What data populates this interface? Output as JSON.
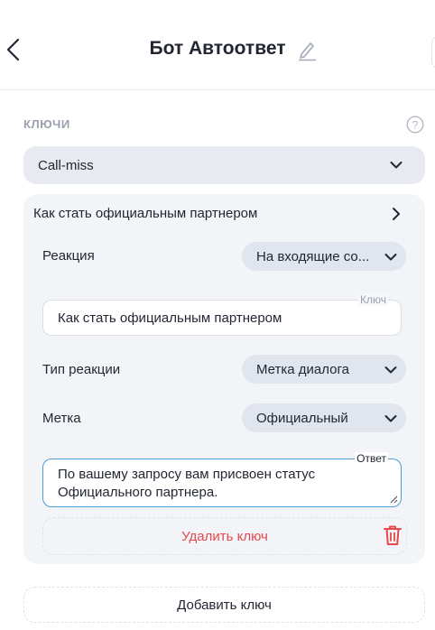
{
  "header": {
    "title": "Бот Автоответ",
    "back_icon": "chevron-left-icon",
    "edit_icon": "pencil-icon"
  },
  "keys_section": {
    "label": "КЛЮЧИ",
    "help_icon": "question-circle-icon",
    "selected": "Call-miss"
  },
  "panel": {
    "title": "Как стать официальным партнером",
    "reaction": {
      "label": "Реакция",
      "value": "На входящие со..."
    },
    "key_field": {
      "legend": "Ключ",
      "value": "Как стать официальным партнером"
    },
    "reaction_type": {
      "label": "Тип реакции",
      "value": "Метка диалога"
    },
    "tag": {
      "label": "Метка",
      "value": "Официальный"
    },
    "answer_field": {
      "legend": "Ответ",
      "line1": "По вашему запросу вам присвоен статус",
      "line2": "Официального партнера."
    },
    "delete_label": "Удалить ключ"
  },
  "add_key_label": "Добавить ключ",
  "colors": {
    "accent_blue": "#4a9bd8",
    "danger_red": "#e5484d",
    "pill_bg": "#e1e5ee",
    "panel_bg": "#f2f4f8"
  }
}
